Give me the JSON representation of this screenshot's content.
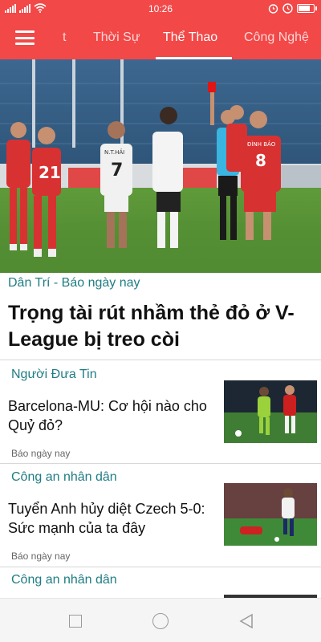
{
  "status_bar": {
    "time": "10:26",
    "battery_level": 0.85,
    "icons": [
      "signal-icon",
      "wifi-icon",
      "alarm-icon",
      "clock-icon",
      "battery-icon"
    ]
  },
  "nav": {
    "menu_icon": "hamburger-icon",
    "tabs": [
      {
        "label": "t",
        "active": false
      },
      {
        "label": "Thời Sự",
        "active": false
      },
      {
        "label": "Thể Thao",
        "active": true
      },
      {
        "label": "Công Nghệ",
        "active": false
      }
    ]
  },
  "colors": {
    "accent": "#f24848",
    "source_text": "#1f7d84"
  },
  "feature": {
    "source": "Dân Trí - Báo ngày nay",
    "title": "Trọng tài rút nhầm thẻ đỏ ở V-League bị treo còi",
    "image": {
      "shirt_numbers": [
        "21",
        "7",
        "8"
      ],
      "shirt_names": [
        "N.T.HẢI",
        "ĐÌNH BẢO"
      ]
    }
  },
  "articles": [
    {
      "source": "Người Đưa Tin",
      "title": "Barcelona-MU: Cơ hội nào cho Quỷ đỏ?",
      "meta": "Báo ngày nay"
    },
    {
      "source": "Công an nhân dân",
      "title": "Tuyển Anh hủy diệt Czech 5-0: Sức mạnh của ta đây",
      "meta": "Báo ngày nay"
    },
    {
      "source": "Công an nhân dân"
    }
  ],
  "bottom_nav": {
    "icons": [
      "recent-apps-icon",
      "home-icon",
      "back-icon"
    ]
  }
}
